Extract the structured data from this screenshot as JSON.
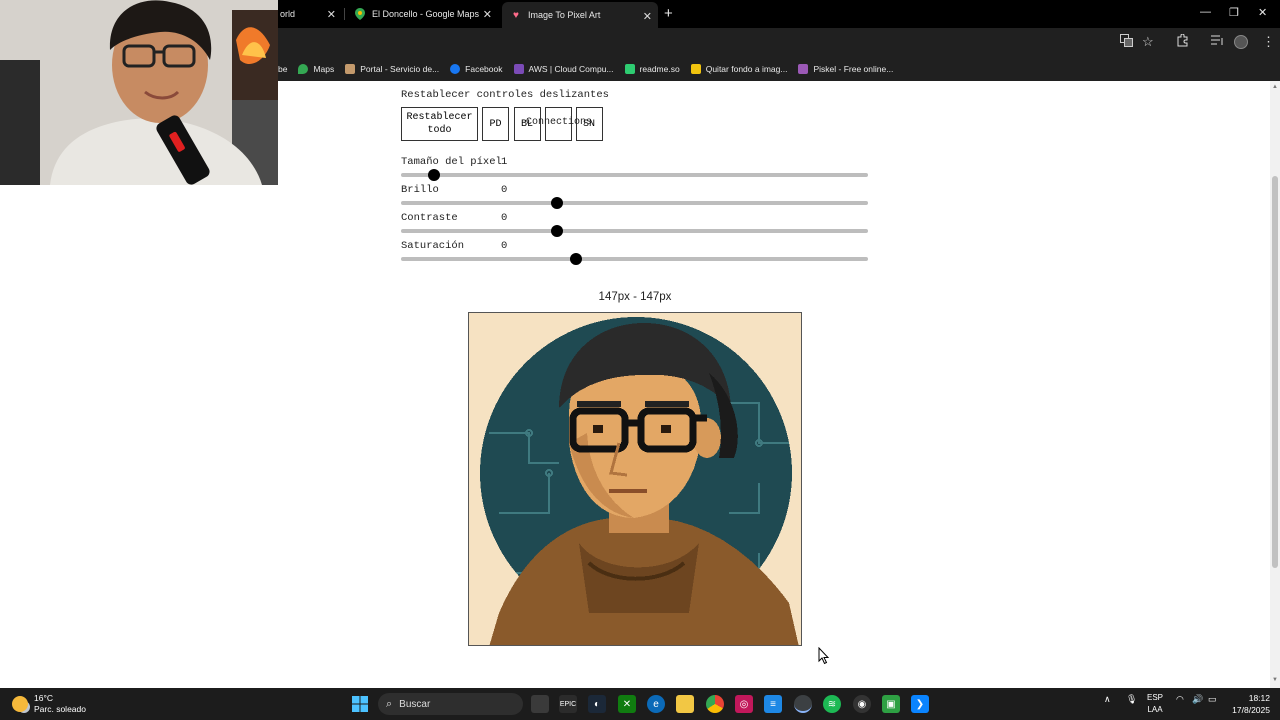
{
  "browser": {
    "tabs": [
      {
        "title": "orld",
        "icon": "globe-icon",
        "active": false
      },
      {
        "title": "El Doncello - Google Maps",
        "icon": "maps-pin-icon",
        "active": false
      },
      {
        "title": "Image To Pixel Art",
        "icon": "heart-icon",
        "active": true
      }
    ],
    "bookmarks": [
      {
        "label": "be",
        "color": "#e53935"
      },
      {
        "label": "Maps",
        "color": "#34a853"
      },
      {
        "label": "Portal - Servicio de...",
        "color": "#c49a6c"
      },
      {
        "label": "Facebook",
        "color": "#1877f2"
      },
      {
        "label": "AWS | Cloud Compu...",
        "color": "#7b4bb7"
      },
      {
        "label": "readme.so",
        "color": "#2ecc71"
      },
      {
        "label": "Quitar fondo a imag...",
        "color": "#f1c40f"
      },
      {
        "label": "Piskel - Free online...",
        "color": "#9b59b6"
      }
    ]
  },
  "controls": {
    "reset_sliders_label": "Restablecer controles deslizantes",
    "buttons": {
      "reset_all": "Restablecer todo",
      "pd": "PD",
      "bl": "BL",
      "connections": "Connections",
      "sn": "SN"
    },
    "sliders": [
      {
        "label": "Tamaño del píxel",
        "value": "1",
        "fraction": 0.07
      },
      {
        "label": "Brillo",
        "value": "0",
        "fraction": 0.335
      },
      {
        "label": "Contraste",
        "value": "0",
        "fraction": 0.335
      },
      {
        "label": "Saturación",
        "value": "0",
        "fraction": 0.375
      }
    ]
  },
  "output": {
    "dimensions": "147px - 147px"
  },
  "taskbar": {
    "weather_temp": "16°C",
    "weather_desc": "Parc. soleado",
    "search_placeholder": "Buscar",
    "lang_line1": "ESP",
    "lang_line2": "LAA",
    "time": "18:12",
    "date": "17/8/2025"
  }
}
